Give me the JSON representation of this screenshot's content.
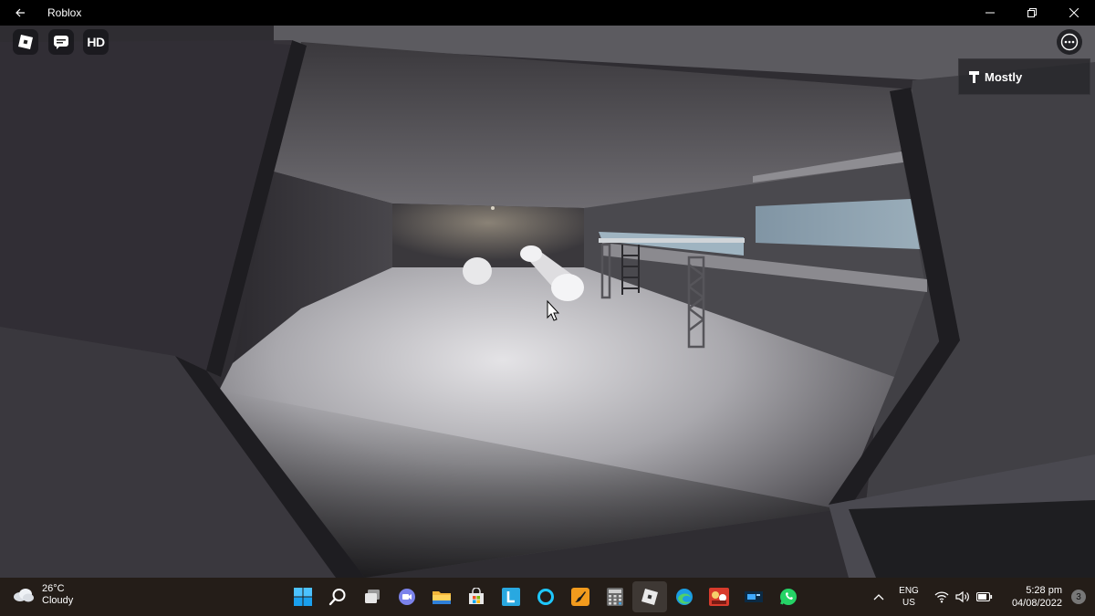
{
  "window": {
    "title": "Roblox",
    "back_icon": "back-arrow-icon",
    "controls": [
      "minimize-icon",
      "restore-icon",
      "close-icon"
    ]
  },
  "game_overlay": {
    "buttons": [
      "roblox-logo-icon",
      "chat-icon"
    ],
    "hd_label": "HD",
    "menu_icon": "more-options-icon",
    "tool": {
      "icon": "hammer-icon",
      "name": "Mostly"
    }
  },
  "taskbar": {
    "weather": {
      "icon": "cloudy-icon",
      "temperature": "26°C",
      "condition": "Cloudy"
    },
    "pinned": [
      "windows-start-icon",
      "search-icon",
      "task-view-icon",
      "teams-chat-icon",
      "file-explorer-icon",
      "microsoft-store-icon",
      "l-app-icon",
      "cortana-icon",
      "paint-app-icon",
      "calculator-icon",
      "roblox-app-icon",
      "edge-icon",
      "game-app-icon",
      "video-app-icon",
      "whatsapp-icon"
    ],
    "active_app": "roblox-app-icon",
    "tray": {
      "language_line1": "ENG",
      "language_line2": "US",
      "time": "5:28 pm",
      "date": "04/08/2022",
      "notification_count": "3"
    }
  },
  "colors": {
    "titlebar": "#000000",
    "taskbar": "#241d18",
    "hallway_floor": "#bdbcc0",
    "wall_frame": "#1e1d21"
  }
}
